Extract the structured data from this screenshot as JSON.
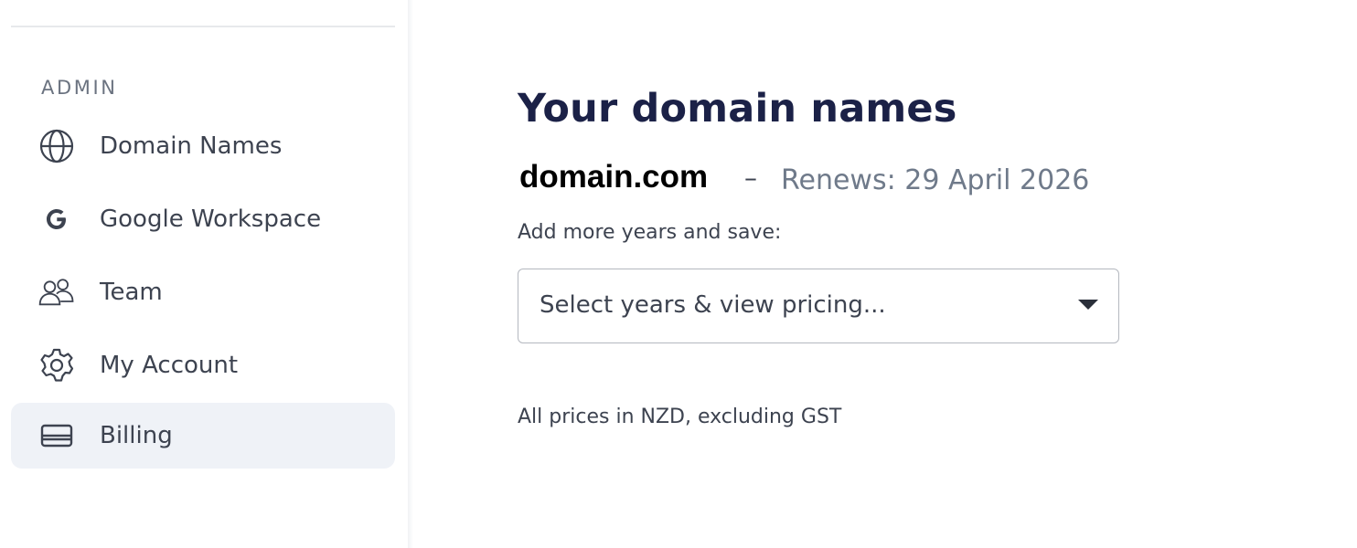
{
  "sidebar": {
    "section_label": "ADMIN",
    "items": [
      {
        "label": "Domain Names",
        "icon": "globe-icon",
        "active": false
      },
      {
        "label": "Google Workspace",
        "icon": "google-g-icon",
        "active": false
      },
      {
        "label": "Team",
        "icon": "team-icon",
        "active": false
      },
      {
        "label": "My Account",
        "icon": "gear-icon",
        "active": false
      },
      {
        "label": "Billing",
        "icon": "credit-card-icon",
        "active": true
      }
    ]
  },
  "main": {
    "title": "Your domain names",
    "domain": {
      "name": "domain.com",
      "separator": "–",
      "renews": "Renews: 29 April 2026"
    },
    "add_years_label": "Add more years and save:",
    "select": {
      "value": "Select years & view pricing..."
    },
    "prices_note": "All prices in NZD, excluding GST"
  },
  "colors": {
    "title": "#1b2147",
    "text": "#3d4350",
    "muted": "#6f7a8a",
    "active_bg": "#eff2f7",
    "border": "#b4b8bf"
  }
}
